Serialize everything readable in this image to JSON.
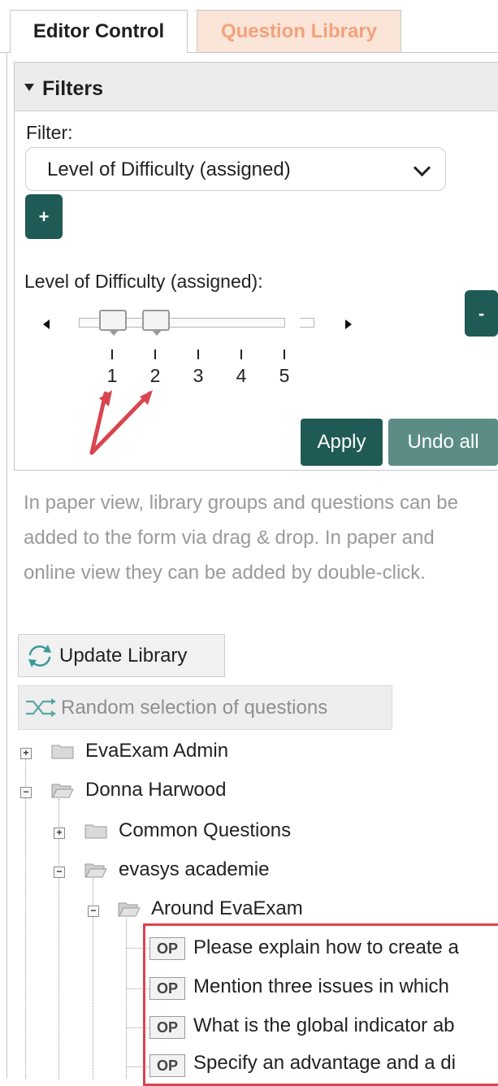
{
  "tabs": [
    {
      "label": "Editor Control",
      "active": true
    },
    {
      "label": "Question Library",
      "active": false
    }
  ],
  "filters": {
    "title": "Filters",
    "filter_label": "Filter:",
    "selected_filter": "Level of Difficulty (assigned)",
    "add_label": "+",
    "remove_label": "-",
    "level_label": "Level of Difficulty (assigned):",
    "slider": {
      "ticks": [
        "1",
        "2",
        "3",
        "4",
        "5"
      ],
      "range_min": 1,
      "range_max": 2
    },
    "apply_label": "Apply",
    "undo_label": "Undo all"
  },
  "info_text": "In paper view, library groups and questions can be added to the form via drag & drop. In paper and online view they can be added by double-click.",
  "update_library_label": "Update Library",
  "random_selection_label": "Random selection of questions",
  "tree": {
    "nodes": [
      {
        "label": "EvaExam Admin",
        "expanded": false
      },
      {
        "label": "Donna Harwood",
        "expanded": true
      },
      {
        "label": "Common Questions",
        "expanded": false
      },
      {
        "label": "evasys academie",
        "expanded": true
      },
      {
        "label": "Around EvaExam",
        "expanded": true
      }
    ],
    "questions": [
      {
        "type": "OP",
        "text": "Please explain how to create a"
      },
      {
        "type": "OP",
        "text": "Mention three issues in which"
      },
      {
        "type": "OP",
        "text": "What is the global indicator ab"
      },
      {
        "type": "OP",
        "text": "Specify an advantage and a di"
      }
    ]
  },
  "colors": {
    "accent_teal": "#1f5a55",
    "undo_teal": "#5b8d86",
    "library_tab_bg": "#fbe4d8",
    "library_tab_text": "#f2a27a",
    "annotation_red": "#d9454f"
  }
}
